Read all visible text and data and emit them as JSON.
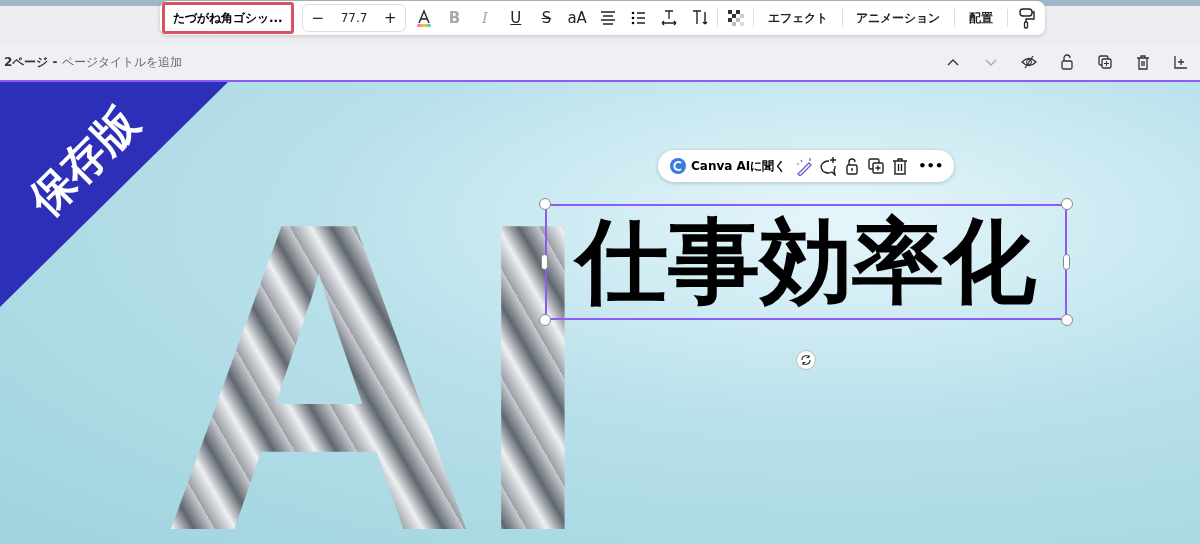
{
  "format_toolbar": {
    "font": "たづがね角ゴシッ...",
    "font_highlighted": true,
    "decrease": "−",
    "size": "77.7",
    "increase": "+",
    "tools": [
      {
        "kind": "text-color"
      },
      {
        "kind": "bold",
        "label": "B",
        "disabled": true
      },
      {
        "kind": "italic",
        "label": "I",
        "disabled": true
      },
      {
        "kind": "underline",
        "label": "U",
        "disabled": false
      },
      {
        "kind": "strike",
        "label": "S",
        "disabled": false
      },
      {
        "kind": "case",
        "label": "aA",
        "disabled": false
      },
      {
        "kind": "align"
      },
      {
        "kind": "list"
      },
      {
        "kind": "spacing"
      },
      {
        "kind": "vertical"
      },
      {
        "kind": "sep"
      },
      {
        "kind": "transparency"
      }
    ],
    "menus": [
      "エフェクト",
      "アニメーション",
      "配置"
    ]
  },
  "page_header": {
    "page": "2ページ -",
    "title_placeholder": "ページタイトルを追加"
  },
  "design": {
    "badge": "保存版",
    "big_letters": "AI",
    "selected_text": "仕事効率化"
  },
  "element_toolbar": {
    "ai_button": "Canva AIに聞く",
    "more": "•••"
  }
}
